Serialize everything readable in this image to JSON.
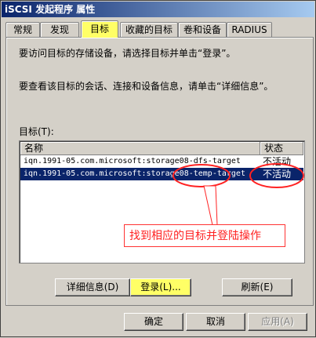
{
  "window": {
    "title": "iSCSI 发起程序 属性"
  },
  "tabs": [
    {
      "label": "常规"
    },
    {
      "label": "发现"
    },
    {
      "label": "目标"
    },
    {
      "label": "收藏的目标"
    },
    {
      "label": "卷和设备"
    },
    {
      "label": "RADIUS"
    }
  ],
  "active_tab": "目标",
  "panel": {
    "instruction_1": "要访问目标的存储设备，请选择目标并单击“登录”。",
    "instruction_2": "要查看该目标的会话、连接和设备信息，请单击“详细信息”。",
    "targets_label": "目标(T):",
    "columns": {
      "name": "名称",
      "status": "状态"
    },
    "rows": [
      {
        "name": "iqn.1991-05.com.microsoft:storage08-dfs-target",
        "status": "不活动",
        "selected": false
      },
      {
        "name": "iqn.1991-05.com.microsoft:storage08-temp-target",
        "status": "不活动",
        "selected": true
      }
    ],
    "annotation": "找到相应的目标并登陆操作",
    "buttons": {
      "details": "详细信息(D)",
      "login": "登录(L)...",
      "refresh": "刷新(E)"
    }
  },
  "footer": {
    "ok": "确定",
    "cancel": "取消",
    "apply": "应用(A)"
  },
  "colors": {
    "highlight": "#ffff66",
    "selection": "#0a246a",
    "annotation": "#ff2222",
    "face": "#d4d0c8"
  }
}
